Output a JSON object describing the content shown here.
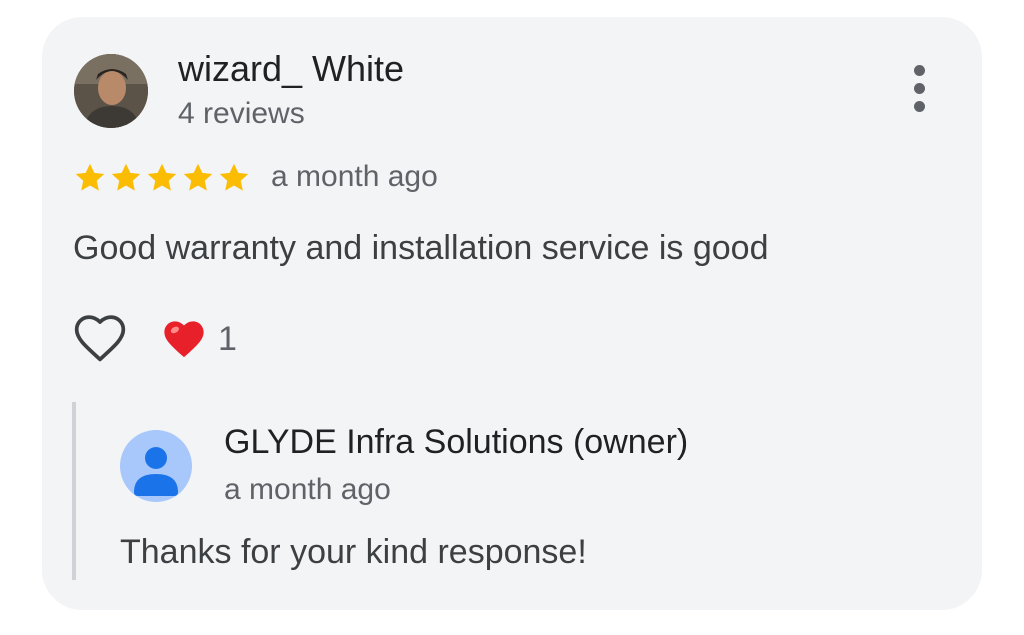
{
  "review": {
    "reviewer_name": "wizard_ White",
    "review_count": "4 reviews",
    "rating": 5,
    "rating_max": 5,
    "date": "a month ago",
    "text": "Good warranty and installation service is good",
    "reaction_count": "1"
  },
  "owner_reply": {
    "name": "GLYDE Infra Solutions (owner)",
    "date": "a month ago",
    "text": "Thanks for your kind response!"
  },
  "icons": {
    "menu": "more-vert-icon",
    "like": "heart-outline-icon",
    "reaction": "red-heart-emoji-icon",
    "star": "star-icon",
    "owner_avatar": "person-icon"
  },
  "colors": {
    "card_background": "#f3f4f6",
    "star": "#fbbc04",
    "reaction_heart": "#e8202a",
    "owner_avatar_bg": "#a8c7fa",
    "owner_avatar_fg": "#1a73e8"
  }
}
